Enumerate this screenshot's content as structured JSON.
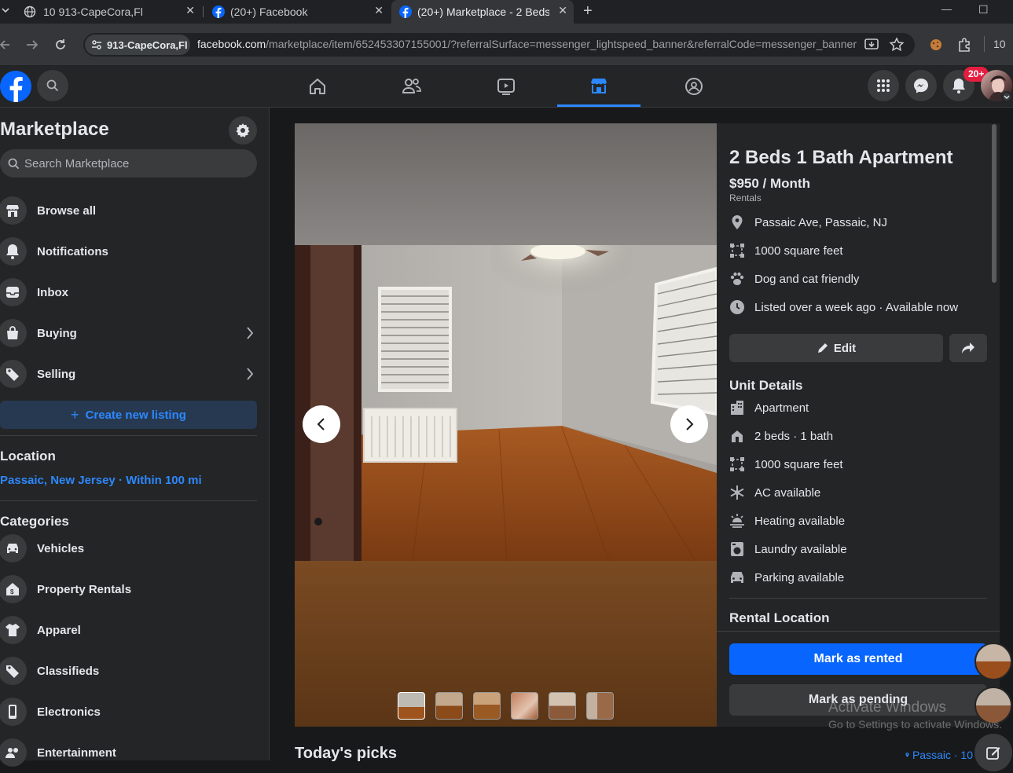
{
  "browser": {
    "tabs": [
      {
        "title": "10 913-CapeCora,Fl",
        "close": "✕"
      },
      {
        "title": "(20+) Facebook",
        "close": "✕"
      },
      {
        "title": "(20+) Marketplace - 2 Beds",
        "close": "✕"
      }
    ],
    "new_tab": "+",
    "minimize": "—",
    "maximize": "☐",
    "site_info": "913-CapeCora,Fl",
    "url_host": "facebook.com",
    "url_path": "/marketplace/item/652453307155001/?referralSurface=messenger_lightspeed_banner&referralCode=messenger_banner",
    "extension_count": "10"
  },
  "header": {
    "notification_badge": "20+"
  },
  "sidebar": {
    "title": "Marketplace",
    "search_placeholder": "Search Marketplace",
    "nav": [
      {
        "label": "Browse all",
        "icon": "storefront-icon"
      },
      {
        "label": "Notifications",
        "icon": "bell-icon"
      },
      {
        "label": "Inbox",
        "icon": "inbox-icon"
      },
      {
        "label": "Buying",
        "icon": "shopping-bag-icon"
      },
      {
        "label": "Selling",
        "icon": "tag-icon"
      }
    ],
    "create_listing": "Create new listing",
    "location_heading": "Location",
    "location_value": "Passaic, New Jersey · Within 100 mi",
    "categories_heading": "Categories",
    "categories": [
      {
        "label": "Vehicles",
        "icon": "car-icon"
      },
      {
        "label": "Property Rentals",
        "icon": "house-icon"
      },
      {
        "label": "Apparel",
        "icon": "shirt-icon"
      },
      {
        "label": "Classifieds",
        "icon": "tag-icon"
      },
      {
        "label": "Electronics",
        "icon": "phone-icon"
      },
      {
        "label": "Entertainment",
        "icon": "people-icon"
      }
    ]
  },
  "listing": {
    "title": "2 Beds 1 Bath Apartment",
    "price": "$950 / Month",
    "category": "Rentals",
    "facts": [
      {
        "text": "Passaic Ave, Passaic, NJ",
        "icon": "location-pin-icon"
      },
      {
        "text": "1000 square feet",
        "icon": "square-footage-icon"
      },
      {
        "text": "Dog and cat friendly",
        "icon": "paw-icon"
      },
      {
        "text": "Listed over a week ago · Available now",
        "icon": "clock-icon"
      }
    ],
    "edit_label": "Edit",
    "unit_details_heading": "Unit Details",
    "unit_details": [
      {
        "text": "Apartment",
        "icon": "building-icon"
      },
      {
        "text": "2 beds · 1 bath",
        "icon": "bed-icon"
      },
      {
        "text": "1000 square feet",
        "icon": "square-footage-icon"
      },
      {
        "text": "AC available",
        "icon": "snowflake-icon"
      },
      {
        "text": "Heating available",
        "icon": "heat-icon"
      },
      {
        "text": "Laundry available",
        "icon": "washer-icon"
      },
      {
        "text": "Parking available",
        "icon": "car-icon"
      }
    ],
    "rental_location_heading": "Rental Location",
    "mark_rented": "Mark as rented",
    "mark_pending": "Mark as pending"
  },
  "todays_picks": "Today's picks",
  "picks_location": "Passaic · 10",
  "watermark": {
    "line1": "Activate Windows",
    "line2": "Go to Settings to activate Windows."
  },
  "colors": {
    "fb_blue": "#0866ff",
    "accent_link": "#2d88ff",
    "notification_red": "#e41e3f",
    "panel_bg": "#242526",
    "page_bg": "#18191a"
  }
}
